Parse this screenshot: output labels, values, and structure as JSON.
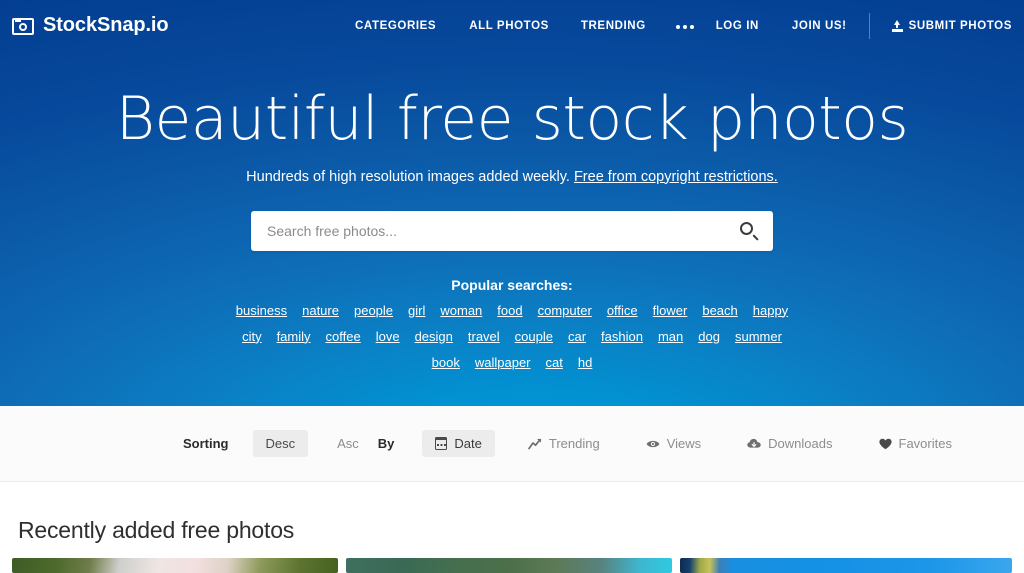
{
  "brand": {
    "name": "StockSnap.io",
    "icon": "camera-icon"
  },
  "nav": {
    "center": [
      {
        "label": "CATEGORIES"
      },
      {
        "label": "ALL PHOTOS"
      },
      {
        "label": "TRENDING"
      }
    ],
    "more_icon": "ellipsis-icon",
    "right": [
      {
        "label": "LOG IN"
      },
      {
        "label": "JOIN US!"
      }
    ],
    "submit": {
      "label": "SUBMIT PHOTOS",
      "icon": "upload-icon"
    }
  },
  "hero": {
    "title": "Beautiful free stock photos",
    "subtitle_plain": "Hundreds of high resolution images added weekly. ",
    "subtitle_link": "Free from copyright restrictions.",
    "search": {
      "placeholder": "Search free photos...",
      "value": "",
      "button_icon": "search-icon"
    },
    "popular_label": "Popular searches:",
    "tag_rows": [
      [
        "business",
        "nature",
        "people",
        "girl",
        "woman",
        "food",
        "computer",
        "office",
        "flower",
        "beach",
        "happy"
      ],
      [
        "city",
        "family",
        "coffee",
        "love",
        "design",
        "travel",
        "couple",
        "car",
        "fashion",
        "man",
        "dog",
        "summer"
      ],
      [
        "book",
        "wallpaper",
        "cat",
        "hd"
      ]
    ]
  },
  "sorting": {
    "sorting_label": "Sorting",
    "direction": [
      {
        "label": "Desc",
        "active": true
      },
      {
        "label": "Asc",
        "active": false
      }
    ],
    "by_label": "By",
    "criteria": [
      {
        "label": "Date",
        "icon": "calendar-icon",
        "active": true
      },
      {
        "label": "Trending",
        "icon": "trending-icon",
        "active": false
      },
      {
        "label": "Views",
        "icon": "eye-icon",
        "active": false
      },
      {
        "label": "Downloads",
        "icon": "download-icon",
        "active": false
      },
      {
        "label": "Favorites",
        "icon": "heart-icon",
        "active": false
      }
    ]
  },
  "gallery": {
    "heading": "Recently added free photos",
    "thumbnails": [
      {
        "alt": "white flower on green foliage"
      },
      {
        "alt": "green field with teal water"
      },
      {
        "alt": "blue sky photograph"
      }
    ]
  },
  "colors": {
    "brand_blue_dark": "#033e92",
    "brand_blue_light": "#00a0e0",
    "nav_text": "#ffffff",
    "sortbar_bg": "#fbfbfb",
    "active_pill": "#ececec",
    "heading_text": "#2f2f2f"
  }
}
